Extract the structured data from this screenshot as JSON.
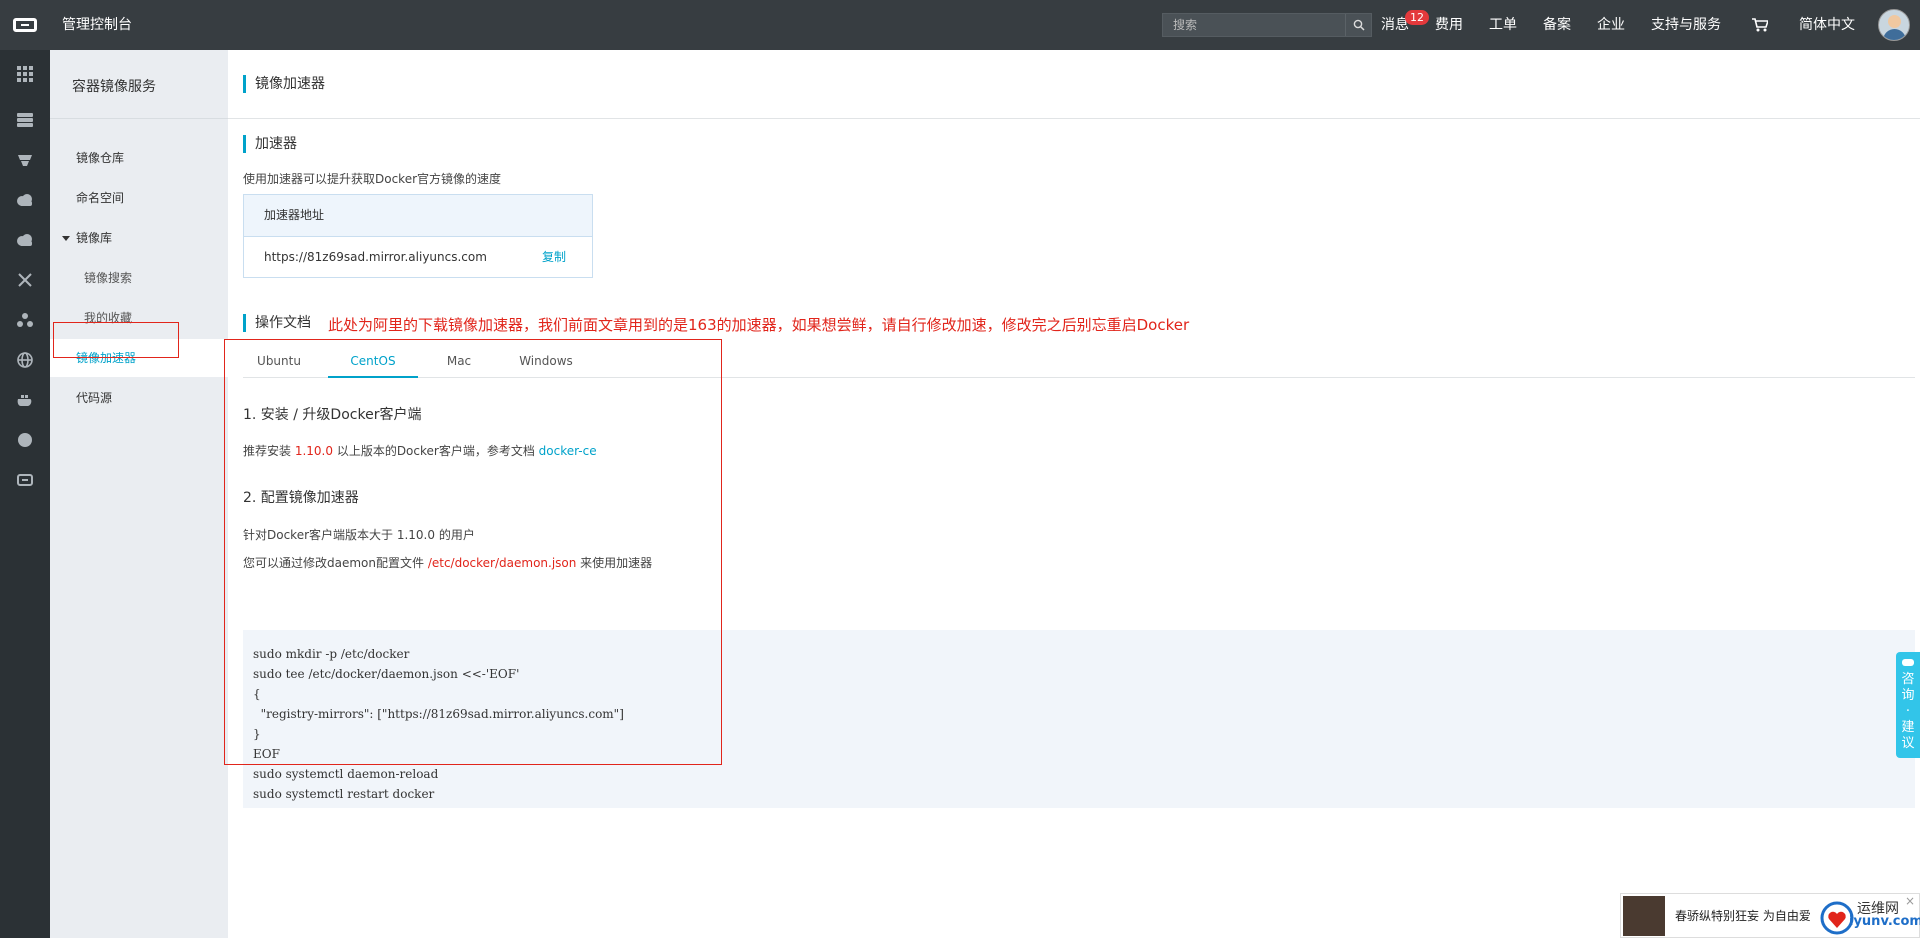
{
  "topbar": {
    "title": "管理控制台",
    "search_placeholder": "搜索",
    "nav": {
      "messages": "消息",
      "messages_badge": "12",
      "billing": "费用",
      "tickets": "工单",
      "icp": "备案",
      "enterprise": "企业",
      "support": "支持与服务",
      "language": "简体中文"
    }
  },
  "sidebar": {
    "title": "容器镜像服务",
    "items": [
      {
        "label": "镜像仓库"
      },
      {
        "label": "命名空间"
      },
      {
        "label": "镜像库"
      },
      {
        "label": "镜像搜索"
      },
      {
        "label": "我的收藏"
      },
      {
        "label": "镜像加速器"
      },
      {
        "label": "代码源"
      }
    ]
  },
  "main": {
    "page_title": "镜像加速器",
    "accelerator": {
      "title": "加速器",
      "hint": "使用加速器可以提升获取Docker官方镜像的速度",
      "address_header": "加速器地址",
      "address": "https://81z69sad.mirror.aliyuncs.com",
      "copy": "复制"
    },
    "docs_title": "操作文档",
    "annotation": "此处为阿里的下载镜像加速器，我们前面文章用到的是163的加速器，如果想尝鲜，请自行修改加速，修改完之后别忘重启Docker",
    "tabs": [
      "Ubuntu",
      "CentOS",
      "Mac",
      "Windows"
    ],
    "step1": {
      "title": "1. 安装 / 升级Docker客户端",
      "text_a": "推荐安装 ",
      "version": "1.10.0",
      "text_b": " 以上版本的Docker客户端，参考文档 ",
      "link": "docker-ce"
    },
    "step2": {
      "title": "2. 配置镜像加速器",
      "line1": "针对Docker客户端版本大于 1.10.0 的用户",
      "line2_a": "您可以通过修改daemon配置文件 ",
      "path": "/etc/docker/daemon.json",
      "line2_b": " 来使用加速器"
    },
    "code": [
      "sudo mkdir -p /etc/docker",
      "sudo tee /etc/docker/daemon.json <<-'EOF'",
      "{",
      "  \"registry-mirrors\": [\"https://81z69sad.mirror.aliyuncs.com\"]",
      "}",
      "EOF",
      "sudo systemctl daemon-reload",
      "sudo systemctl restart docker"
    ]
  },
  "float_button": [
    "咨",
    "询",
    "·",
    "建",
    "议"
  ],
  "ad": {
    "text": "春骄纵特别狂妄  为自由爱",
    "logo_top": "运维网",
    "logo_bottom": "iyunv.com",
    "close": "×"
  },
  "colors": {
    "accent": "#00a2ca",
    "annotation_red": "#e1251b",
    "topbar": "#373d41",
    "iconbar": "#2b3135",
    "sidebar": "#eaedf1"
  }
}
